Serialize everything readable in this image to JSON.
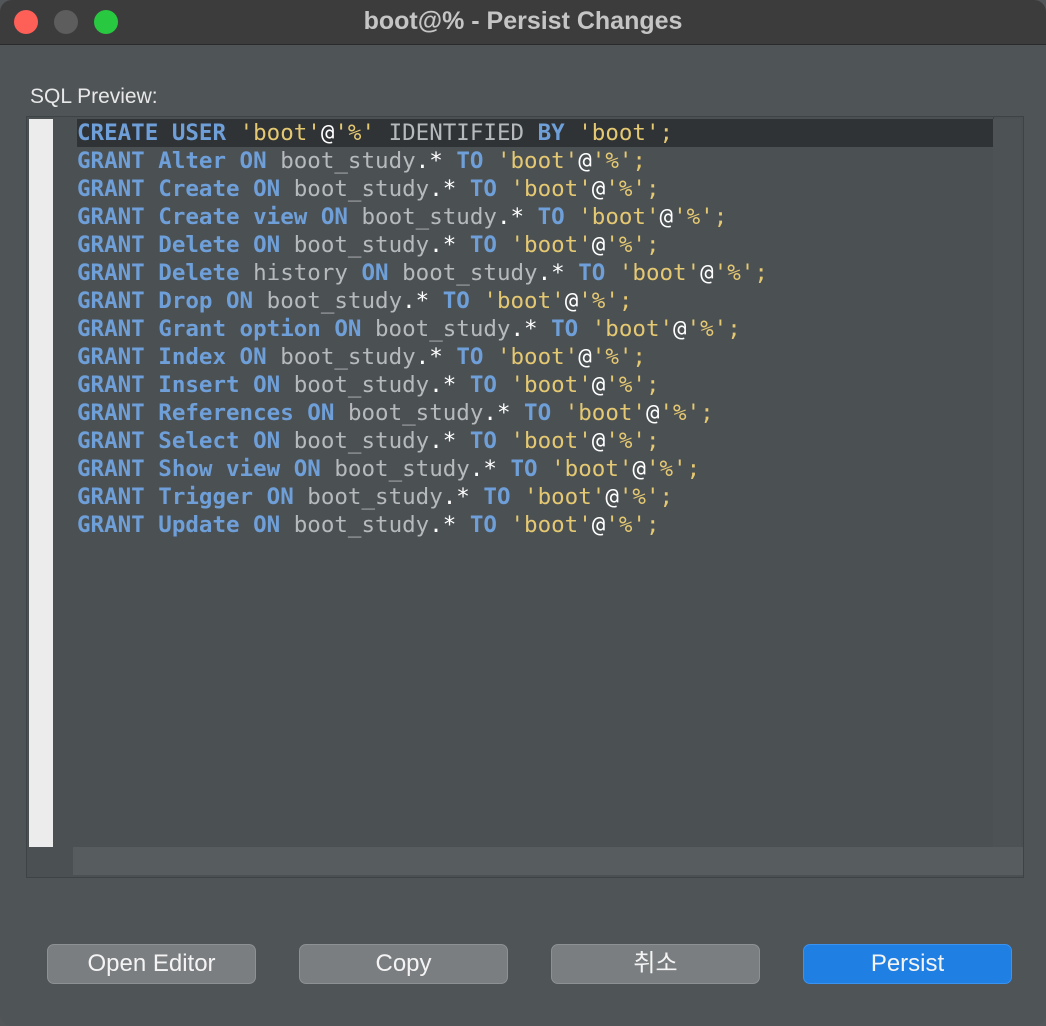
{
  "window": {
    "title": "boot@% - Persist Changes"
  },
  "preview": {
    "label": "SQL Preview:",
    "lines": [
      {
        "tokens": [
          {
            "t": "CREATE USER ",
            "c": "kw"
          },
          {
            "t": "'boot'",
            "c": "str"
          },
          {
            "t": "@",
            "c": "op"
          },
          {
            "t": "'%'",
            "c": "str"
          },
          {
            "t": " IDENTIFIED ",
            "c": "id"
          },
          {
            "t": "BY ",
            "c": "kw"
          },
          {
            "t": "'boot';",
            "c": "str"
          }
        ]
      },
      {
        "tokens": [
          {
            "t": "GRANT Alter ON ",
            "c": "kw"
          },
          {
            "t": "boot_study",
            "c": "id"
          },
          {
            "t": ".* ",
            "c": "op"
          },
          {
            "t": "TO ",
            "c": "kw"
          },
          {
            "t": "'boot'",
            "c": "str"
          },
          {
            "t": "@",
            "c": "op"
          },
          {
            "t": "'%';",
            "c": "str"
          }
        ]
      },
      {
        "tokens": [
          {
            "t": "GRANT Create ON ",
            "c": "kw"
          },
          {
            "t": "boot_study",
            "c": "id"
          },
          {
            "t": ".* ",
            "c": "op"
          },
          {
            "t": "TO ",
            "c": "kw"
          },
          {
            "t": "'boot'",
            "c": "str"
          },
          {
            "t": "@",
            "c": "op"
          },
          {
            "t": "'%';",
            "c": "str"
          }
        ]
      },
      {
        "tokens": [
          {
            "t": "GRANT Create view ON ",
            "c": "kw"
          },
          {
            "t": "boot_study",
            "c": "id"
          },
          {
            "t": ".* ",
            "c": "op"
          },
          {
            "t": "TO ",
            "c": "kw"
          },
          {
            "t": "'boot'",
            "c": "str"
          },
          {
            "t": "@",
            "c": "op"
          },
          {
            "t": "'%';",
            "c": "str"
          }
        ]
      },
      {
        "tokens": [
          {
            "t": "GRANT Delete ON ",
            "c": "kw"
          },
          {
            "t": "boot_study",
            "c": "id"
          },
          {
            "t": ".* ",
            "c": "op"
          },
          {
            "t": "TO ",
            "c": "kw"
          },
          {
            "t": "'boot'",
            "c": "str"
          },
          {
            "t": "@",
            "c": "op"
          },
          {
            "t": "'%';",
            "c": "str"
          }
        ]
      },
      {
        "tokens": [
          {
            "t": "GRANT Delete ",
            "c": "kw"
          },
          {
            "t": "history ",
            "c": "id"
          },
          {
            "t": "ON ",
            "c": "kw"
          },
          {
            "t": "boot_study",
            "c": "id"
          },
          {
            "t": ".* ",
            "c": "op"
          },
          {
            "t": "TO ",
            "c": "kw"
          },
          {
            "t": "'boot'",
            "c": "str"
          },
          {
            "t": "@",
            "c": "op"
          },
          {
            "t": "'%';",
            "c": "str"
          }
        ]
      },
      {
        "tokens": [
          {
            "t": "GRANT Drop ON ",
            "c": "kw"
          },
          {
            "t": "boot_study",
            "c": "id"
          },
          {
            "t": ".* ",
            "c": "op"
          },
          {
            "t": "TO ",
            "c": "kw"
          },
          {
            "t": "'boot'",
            "c": "str"
          },
          {
            "t": "@",
            "c": "op"
          },
          {
            "t": "'%';",
            "c": "str"
          }
        ]
      },
      {
        "tokens": [
          {
            "t": "GRANT Grant option ON ",
            "c": "kw"
          },
          {
            "t": "boot_study",
            "c": "id"
          },
          {
            "t": ".* ",
            "c": "op"
          },
          {
            "t": "TO ",
            "c": "kw"
          },
          {
            "t": "'boot'",
            "c": "str"
          },
          {
            "t": "@",
            "c": "op"
          },
          {
            "t": "'%';",
            "c": "str"
          }
        ]
      },
      {
        "tokens": [
          {
            "t": "GRANT Index ON ",
            "c": "kw"
          },
          {
            "t": "boot_study",
            "c": "id"
          },
          {
            "t": ".* ",
            "c": "op"
          },
          {
            "t": "TO ",
            "c": "kw"
          },
          {
            "t": "'boot'",
            "c": "str"
          },
          {
            "t": "@",
            "c": "op"
          },
          {
            "t": "'%';",
            "c": "str"
          }
        ]
      },
      {
        "tokens": [
          {
            "t": "GRANT Insert ON ",
            "c": "kw"
          },
          {
            "t": "boot_study",
            "c": "id"
          },
          {
            "t": ".* ",
            "c": "op"
          },
          {
            "t": "TO ",
            "c": "kw"
          },
          {
            "t": "'boot'",
            "c": "str"
          },
          {
            "t": "@",
            "c": "op"
          },
          {
            "t": "'%';",
            "c": "str"
          }
        ]
      },
      {
        "tokens": [
          {
            "t": "GRANT References ON ",
            "c": "kw"
          },
          {
            "t": "boot_study",
            "c": "id"
          },
          {
            "t": ".* ",
            "c": "op"
          },
          {
            "t": "TO ",
            "c": "kw"
          },
          {
            "t": "'boot'",
            "c": "str"
          },
          {
            "t": "@",
            "c": "op"
          },
          {
            "t": "'%';",
            "c": "str"
          }
        ]
      },
      {
        "tokens": [
          {
            "t": "GRANT Select ON ",
            "c": "kw"
          },
          {
            "t": "boot_study",
            "c": "id"
          },
          {
            "t": ".* ",
            "c": "op"
          },
          {
            "t": "TO ",
            "c": "kw"
          },
          {
            "t": "'boot'",
            "c": "str"
          },
          {
            "t": "@",
            "c": "op"
          },
          {
            "t": "'%';",
            "c": "str"
          }
        ]
      },
      {
        "tokens": [
          {
            "t": "GRANT Show view ON ",
            "c": "kw"
          },
          {
            "t": "boot_study",
            "c": "id"
          },
          {
            "t": ".* ",
            "c": "op"
          },
          {
            "t": "TO ",
            "c": "kw"
          },
          {
            "t": "'boot'",
            "c": "str"
          },
          {
            "t": "@",
            "c": "op"
          },
          {
            "t": "'%';",
            "c": "str"
          }
        ]
      },
      {
        "tokens": [
          {
            "t": "GRANT Trigger ON ",
            "c": "kw"
          },
          {
            "t": "boot_study",
            "c": "id"
          },
          {
            "t": ".* ",
            "c": "op"
          },
          {
            "t": "TO ",
            "c": "kw"
          },
          {
            "t": "'boot'",
            "c": "str"
          },
          {
            "t": "@",
            "c": "op"
          },
          {
            "t": "'%';",
            "c": "str"
          }
        ]
      },
      {
        "tokens": [
          {
            "t": "GRANT Update ON ",
            "c": "kw"
          },
          {
            "t": "boot_study",
            "c": "id"
          },
          {
            "t": ".* ",
            "c": "op"
          },
          {
            "t": "TO ",
            "c": "kw"
          },
          {
            "t": "'boot'",
            "c": "str"
          },
          {
            "t": "@",
            "c": "op"
          },
          {
            "t": "'%';",
            "c": "str"
          }
        ]
      }
    ]
  },
  "buttons": {
    "open_editor": "Open Editor",
    "copy": "Copy",
    "cancel": "취소",
    "persist": "Persist"
  },
  "colors": {
    "keyword": "#6f9fd8",
    "string": "#e5c872",
    "identifier": "#b7babd",
    "operator": "#ffffff",
    "primary_button": "#1f7fe3"
  }
}
